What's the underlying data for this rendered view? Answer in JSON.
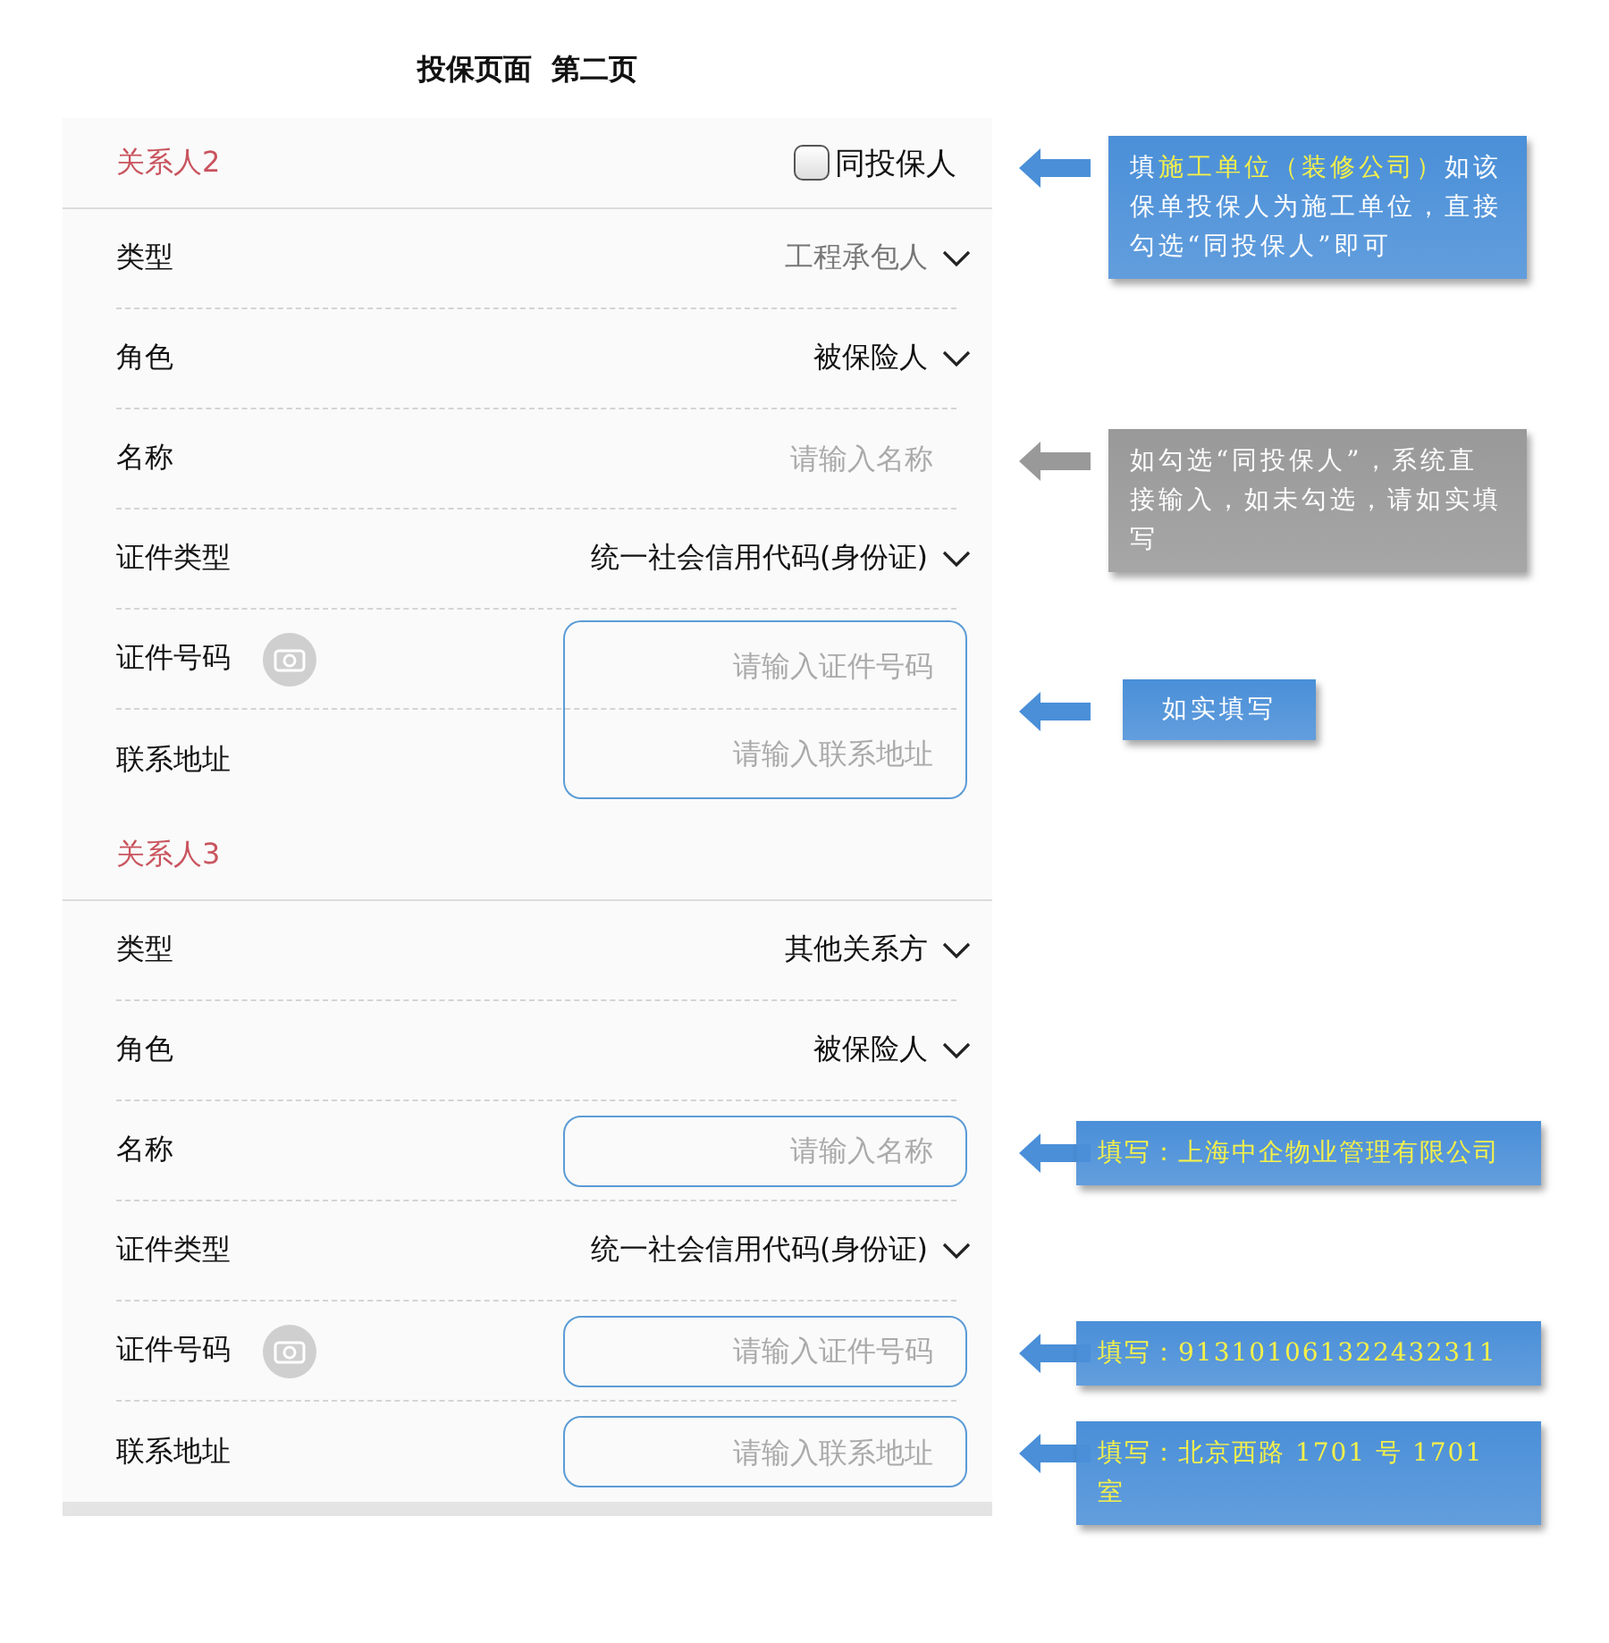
{
  "page_title": "投保页面  第二页",
  "sections": [
    {
      "title": "关系人2",
      "same_as_policyholder": {
        "label": "同投保人",
        "checked": false
      },
      "joined_outline": true,
      "note": {
        "kind": "note",
        "color": "#4a8fd8",
        "text": "填**施工单位（装修公司）**如该保单投保人为施工单位，直接勾选“同投保人”即可"
      },
      "rows": [
        {
          "kind": "select",
          "label": "类型",
          "value": "工程承包人",
          "disabled": true
        },
        {
          "kind": "select",
          "label": "角色",
          "value": "被保险人",
          "disabled": false
        },
        {
          "kind": "input",
          "label": "名称",
          "placeholder": "请输入名称",
          "outlined": false,
          "note": {
            "kind": "note",
            "color": "#999999",
            "text": "如勾选“同投保人”，系统直接输入，如未勾选，请如实填写"
          }
        },
        {
          "kind": "select",
          "label": "证件类型",
          "value": "统一社会信用代码(身份证)",
          "disabled": false
        },
        {
          "kind": "input",
          "label": "证件号码",
          "placeholder": "请输入证件号码",
          "has_camera": true,
          "outlined": true,
          "note": {
            "kind": "short",
            "color": "#4a8fd8",
            "text": "如实填写"
          }
        },
        {
          "kind": "input",
          "label": "联系地址",
          "placeholder": "请输入联系地址",
          "outlined": true
        }
      ]
    },
    {
      "title": "关系人3",
      "joined_outline": false,
      "rows": [
        {
          "kind": "select",
          "label": "类型",
          "value": "其他关系方",
          "disabled": false
        },
        {
          "kind": "select",
          "label": "角色",
          "value": "被保险人",
          "disabled": false
        },
        {
          "kind": "input",
          "label": "名称",
          "placeholder": "请输入名称",
          "outlined": true,
          "note": {
            "kind": "value",
            "color": "#4a8fd8",
            "text": "填写：上海中企物业管理有限公司"
          }
        },
        {
          "kind": "select",
          "label": "证件类型",
          "value": "统一社会信用代码(身份证)",
          "disabled": false
        },
        {
          "kind": "input",
          "label": "证件号码",
          "placeholder": "请输入证件号码",
          "has_camera": true,
          "outlined": true,
          "note": {
            "kind": "value",
            "color": "#4a8fd8",
            "text": "填写：913101061322432311"
          }
        },
        {
          "kind": "input",
          "label": "联系地址",
          "placeholder": "请输入联系地址",
          "outlined": true,
          "note": {
            "kind": "value",
            "color": "#4a8fd8",
            "text": "填写：北京西路 1701 号 1701 室"
          }
        }
      ]
    }
  ]
}
